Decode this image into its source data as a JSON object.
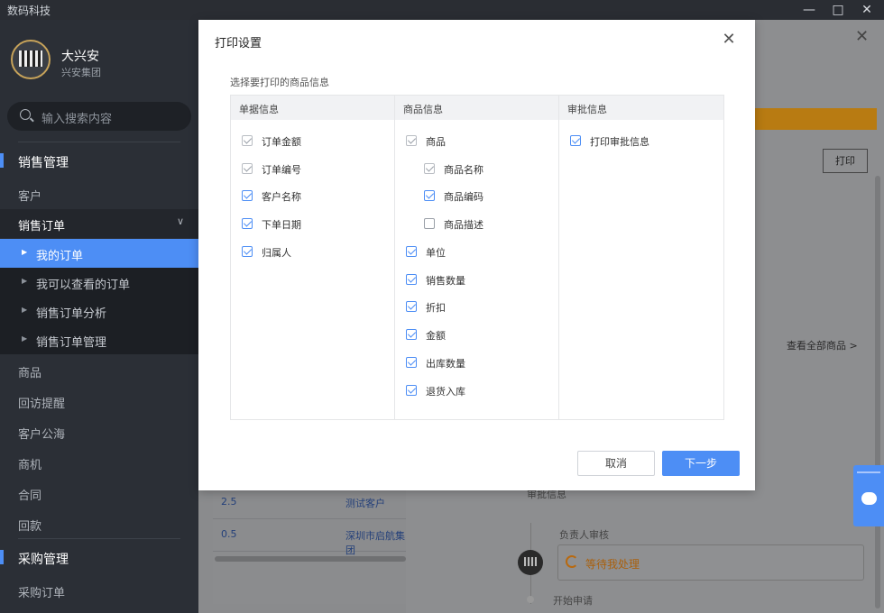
{
  "window": {
    "title": "数码科技",
    "minimize": "—",
    "maximize": "□",
    "close": "✕"
  },
  "sidebar": {
    "user": {
      "name": "大兴安",
      "company": "兴安集团"
    },
    "search": {
      "placeholder": "输入搜索内容"
    },
    "sections": [
      {
        "label": "销售管理"
      },
      {
        "label": "采购管理"
      }
    ],
    "items": {
      "customer": "客户",
      "sales_order": "销售订单",
      "sub": [
        "我的订单",
        "我可以查看的订单",
        "销售订单分析",
        "销售订单管理"
      ],
      "product": "商品",
      "visit": "回访提醒",
      "pool": "客户公海",
      "opportunity": "商机",
      "contract": "合同",
      "payment": "回款",
      "purchase_order": "采购订单"
    }
  },
  "background": {
    "print_button": "打印",
    "view_all": "查看全部商品 >",
    "rows": [
      {
        "a": "2.5",
        "b": "测试客户"
      },
      {
        "a": "0.5",
        "b": "深圳市启航集团"
      }
    ],
    "approval_header": "审批信息",
    "step_owner": "负责人审核",
    "status": "等待我处理",
    "step_start": "开始申请"
  },
  "dialog": {
    "title": "打印设置",
    "close": "✕",
    "section_label": "选择要打印的商品信息",
    "columns": [
      {
        "header": "单据信息",
        "options": [
          {
            "label": "订单金额",
            "checked": true,
            "locked": true
          },
          {
            "label": "订单编号",
            "checked": true,
            "locked": true
          },
          {
            "label": "客户名称",
            "checked": true
          },
          {
            "label": "下单日期",
            "checked": true
          },
          {
            "label": "归属人",
            "checked": true
          }
        ]
      },
      {
        "header": "商品信息",
        "options": [
          {
            "label": "商品",
            "checked": true,
            "locked": true
          },
          {
            "label": "商品名称",
            "checked": true,
            "locked": true
          },
          {
            "label": "商品编码",
            "checked": true
          },
          {
            "label": "商品描述",
            "checked": false
          },
          {
            "label": "单位",
            "checked": true
          },
          {
            "label": "销售数量",
            "checked": true
          },
          {
            "label": "折扣",
            "checked": true
          },
          {
            "label": "金额",
            "checked": true
          },
          {
            "label": "出库数量",
            "checked": true
          },
          {
            "label": "退货入库",
            "checked": true
          }
        ]
      },
      {
        "header": "审批信息",
        "options": [
          {
            "label": "打印审批信息",
            "checked": true
          }
        ]
      }
    ],
    "cancel": "取消",
    "next": "下一步"
  },
  "colors": {
    "accent": "#4d8ef5",
    "sidebar_bg": "#2b2f36",
    "orange": "#f39c12"
  }
}
